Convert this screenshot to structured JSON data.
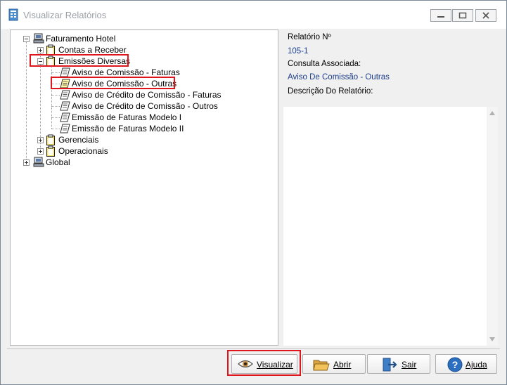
{
  "window": {
    "title": "Visualizar Relatórios"
  },
  "tree": {
    "root": "Faturamento Hotel",
    "contas": "Contas a Receber",
    "emissoes": "Emissões Diversas",
    "reports": [
      "Aviso de Comissão - Faturas",
      "Aviso de Comissão - Outras",
      "Aviso de Crédito de Comissão - Faturas",
      "Aviso de Crédito de Comissão - Outros",
      "Emissão de Faturas Modelo I",
      "Emissão de Faturas Modelo II"
    ],
    "gerenciais": "Gerenciais",
    "operacionais": "Operacionais",
    "global": "Global"
  },
  "info": {
    "relatorio_label": "Relatório Nº",
    "relatorio_value": "105-1",
    "consulta_label": "Consulta Associada:",
    "consulta_value": "Aviso De Comissão - Outras",
    "descricao_label": "Descrição Do Relatório:"
  },
  "buttons": {
    "visualizar": "Visualizar",
    "abrir": "Abrir",
    "sair": "Sair",
    "ajuda": "Ajuda"
  },
  "colors": {
    "highlight": "#e0141c",
    "info_value": "#1c3e8c"
  }
}
